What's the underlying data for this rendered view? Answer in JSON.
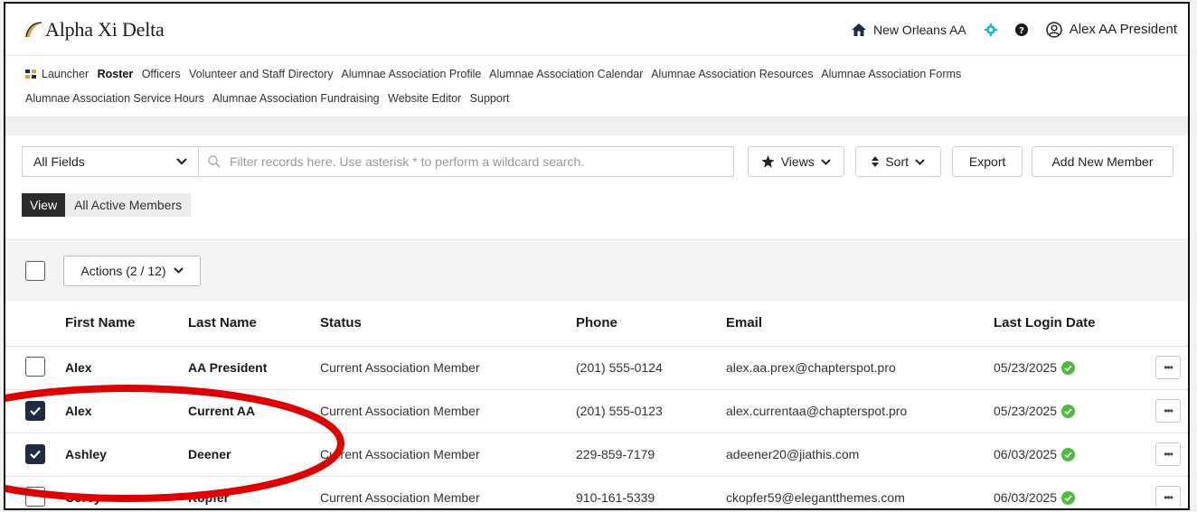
{
  "app": {
    "logo_text": "Alpha Xi Delta",
    "chapter": "New Orleans AA",
    "user_name": "Alex AA President"
  },
  "nav": {
    "items": [
      {
        "label": "Launcher",
        "active": false
      },
      {
        "label": "Roster",
        "active": true
      },
      {
        "label": "Officers",
        "active": false
      },
      {
        "label": "Volunteer and Staff Directory",
        "active": false
      },
      {
        "label": "Alumnae Association Profile",
        "active": false
      },
      {
        "label": "Alumnae Association Calendar",
        "active": false
      },
      {
        "label": "Alumnae Association Resources",
        "active": false
      },
      {
        "label": "Alumnae Association Forms",
        "active": false
      },
      {
        "label": "Alumnae Association Service Hours",
        "active": false
      },
      {
        "label": "Alumnae Association Fundraising",
        "active": false
      },
      {
        "label": "Website Editor",
        "active": false
      },
      {
        "label": "Support",
        "active": false
      }
    ]
  },
  "toolbar": {
    "field_select": "All Fields",
    "search_placeholder": "Filter records here. Use asterisk * to perform a wildcard search.",
    "views_label": "Views",
    "sort_label": "Sort",
    "export_label": "Export",
    "add_label": "Add New Member",
    "view_tag": "View",
    "view_name": "All Active Members"
  },
  "actions": {
    "label": "Actions (2 / 12)"
  },
  "table": {
    "headers": {
      "first_name": "First Name",
      "last_name": "Last Name",
      "status": "Status",
      "phone": "Phone",
      "email": "Email",
      "last_login": "Last Login Date"
    },
    "rows": [
      {
        "first": "Alex",
        "last": "AA President",
        "status": "Current Association Member",
        "phone": "(201) 555-0124",
        "email": "alex.aa.prex@chapterspot.pro",
        "login": "05/23/2025",
        "checked": false
      },
      {
        "first": "Alex",
        "last": "Current AA",
        "status": "Current Association Member",
        "phone": "(201) 555-0123",
        "email": "alex.currentaa@chapterspot.pro",
        "login": "05/23/2025",
        "checked": true
      },
      {
        "first": "Ashley",
        "last": "Deener",
        "status": "Current Association Member",
        "phone": "229-859-7179",
        "email": "adeener20@jiathis.com",
        "login": "06/03/2025",
        "checked": true
      },
      {
        "first": "Corey",
        "last": "Kopfer",
        "status": "Current Association Member",
        "phone": "910-161-5339",
        "email": "ckopfer59@elegantthemes.com",
        "login": "06/03/2025",
        "checked": false
      }
    ]
  },
  "colors": {
    "accent_gold": "#d7a63a",
    "chapter_icon": "#1f2a44",
    "status_gear": "#19b6d6",
    "check_green": "#4cbb3a",
    "checkbox_checked": "#1f2a44",
    "annotation_red": "#e00000"
  }
}
